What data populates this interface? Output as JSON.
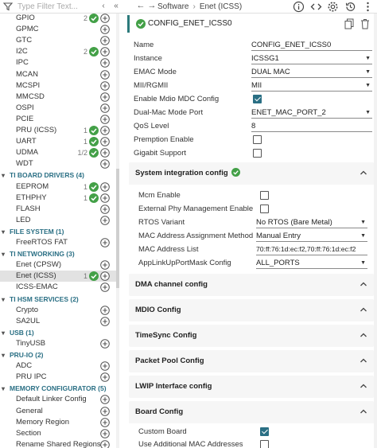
{
  "toolbar": {
    "filter_placeholder": "Type Filter Text...",
    "breadcrumb": [
      "Software",
      "Enet (ICSS)"
    ]
  },
  "sidebar": {
    "rows": [
      {
        "label": "GPIO",
        "count": "2",
        "check": true,
        "add": true
      },
      {
        "label": "GPMC",
        "count": "",
        "check": false,
        "add": true
      },
      {
        "label": "GTC",
        "count": "",
        "check": false,
        "add": true
      },
      {
        "label": "I2C",
        "count": "2",
        "check": true,
        "add": true
      },
      {
        "label": "IPC",
        "count": "",
        "check": false,
        "add": true
      },
      {
        "label": "MCAN",
        "count": "",
        "check": false,
        "add": true
      },
      {
        "label": "MCSPI",
        "count": "",
        "check": false,
        "add": true
      },
      {
        "label": "MMCSD",
        "count": "",
        "check": false,
        "add": true
      },
      {
        "label": "OSPI",
        "count": "",
        "check": false,
        "add": true
      },
      {
        "label": "PCIE",
        "count": "",
        "check": false,
        "add": true
      },
      {
        "label": "PRU (ICSS)",
        "count": "1",
        "check": true,
        "add": true
      },
      {
        "label": "UART",
        "count": "1",
        "check": true,
        "add": true
      },
      {
        "label": "UDMA",
        "count": "1/2",
        "check": true,
        "add": true
      },
      {
        "label": "WDT",
        "count": "",
        "check": false,
        "add": true
      }
    ],
    "groups": [
      {
        "label": "TI BOARD DRIVERS (4)",
        "rows": [
          {
            "label": "EEPROM",
            "count": "1",
            "check": true,
            "add": true
          },
          {
            "label": "ETHPHY",
            "count": "1",
            "check": true,
            "add": true
          },
          {
            "label": "FLASH",
            "count": "",
            "check": false,
            "add": true
          },
          {
            "label": "LED",
            "count": "",
            "check": false,
            "add": true
          }
        ]
      },
      {
        "label": "FILE SYSTEM (1)",
        "rows": [
          {
            "label": "FreeRTOS FAT",
            "count": "",
            "check": false,
            "add": true
          }
        ]
      },
      {
        "label": "TI NETWORKING (3)",
        "rows": [
          {
            "label": "Enet (CPSW)",
            "count": "",
            "check": false,
            "add": true
          },
          {
            "label": "Enet (ICSS)",
            "count": "1",
            "check": true,
            "add": true,
            "selected": true
          },
          {
            "label": "ICSS-EMAC",
            "count": "",
            "check": false,
            "add": true
          }
        ]
      },
      {
        "label": "TI HSM SERVICES (2)",
        "rows": [
          {
            "label": "Crypto",
            "count": "",
            "check": false,
            "add": true
          },
          {
            "label": "SA2UL",
            "count": "",
            "check": false,
            "add": true
          }
        ]
      },
      {
        "label": "USB (1)",
        "rows": [
          {
            "label": "TinyUSB",
            "count": "",
            "check": false,
            "add": true
          }
        ]
      },
      {
        "label": "PRU-IO (2)",
        "rows": [
          {
            "label": "ADC",
            "count": "",
            "check": false,
            "add": true
          },
          {
            "label": "PRU IPC",
            "count": "",
            "check": false,
            "add": true
          }
        ]
      },
      {
        "label": "MEMORY CONFIGURATOR (5)",
        "rows": [
          {
            "label": "Default Linker Config",
            "count": "",
            "check": false,
            "add": true
          },
          {
            "label": "General",
            "count": "",
            "check": false,
            "add": true
          },
          {
            "label": "Memory Region",
            "count": "",
            "check": false,
            "add": true
          },
          {
            "label": "Section",
            "count": "",
            "check": false,
            "add": true
          },
          {
            "label": "Rename Shared Regions",
            "count": "",
            "check": false,
            "add": true
          }
        ]
      }
    ]
  },
  "instance": {
    "title": "CONFIG_ENET_ICSS0",
    "props": {
      "name": {
        "label": "Name",
        "value": "CONFIG_ENET_ICSS0"
      },
      "instance": {
        "label": "Instance",
        "value": "ICSSG1"
      },
      "emac_mode": {
        "label": "EMAC Mode",
        "value": "DUAL MAC"
      },
      "mii": {
        "label": "MII/RGMII",
        "value": "MII"
      },
      "mdio": {
        "label": "Enable Mdio MDC Config",
        "checked": true
      },
      "dual_mac_port": {
        "label": "Dual-Mac Mode Port",
        "value": "ENET_MAC_PORT_2"
      },
      "qos": {
        "label": "QoS Level",
        "value": "8"
      },
      "premption": {
        "label": "Premption Enable",
        "checked": false
      },
      "gigabit": {
        "label": "Gigabit Support",
        "checked": false
      }
    }
  },
  "sections": {
    "system": {
      "title": "System integration config",
      "props": {
        "mcm": {
          "label": "Mcm Enable",
          "checked": false
        },
        "ext_phy": {
          "label": "External Phy Management Enable...",
          "checked": false
        },
        "rtos": {
          "label": "RTOS Variant",
          "value": "No RTOS (Bare Metal)"
        },
        "mac_method": {
          "label": "MAC Address Assignment Method...",
          "value": "Manual Entry"
        },
        "mac_list": {
          "label": "MAC Address List",
          "value": "70:ff:76:1d:ec:f2,70:ff:76:1d:ec:f2"
        },
        "applink": {
          "label": "AppLinkUpPortMask Config",
          "value": "ALL_PORTS"
        }
      }
    },
    "dma": {
      "title": "DMA channel config"
    },
    "mdio": {
      "title": "MDIO Config"
    },
    "timesync": {
      "title": "TimeSync Config"
    },
    "packet_pool": {
      "title": "Packet Pool Config"
    },
    "lwip": {
      "title": "LWIP Interface config"
    },
    "board": {
      "title": "Board Config",
      "props": {
        "custom_board": {
          "label": "Custom Board",
          "checked": true
        },
        "additional_mac": {
          "label": "Use Additional MAC Addresses",
          "checked": false
        }
      }
    }
  },
  "colors": {
    "accent": "#2a6f84",
    "check_green": "#43a047",
    "title_bar": "#2c7a7b"
  }
}
